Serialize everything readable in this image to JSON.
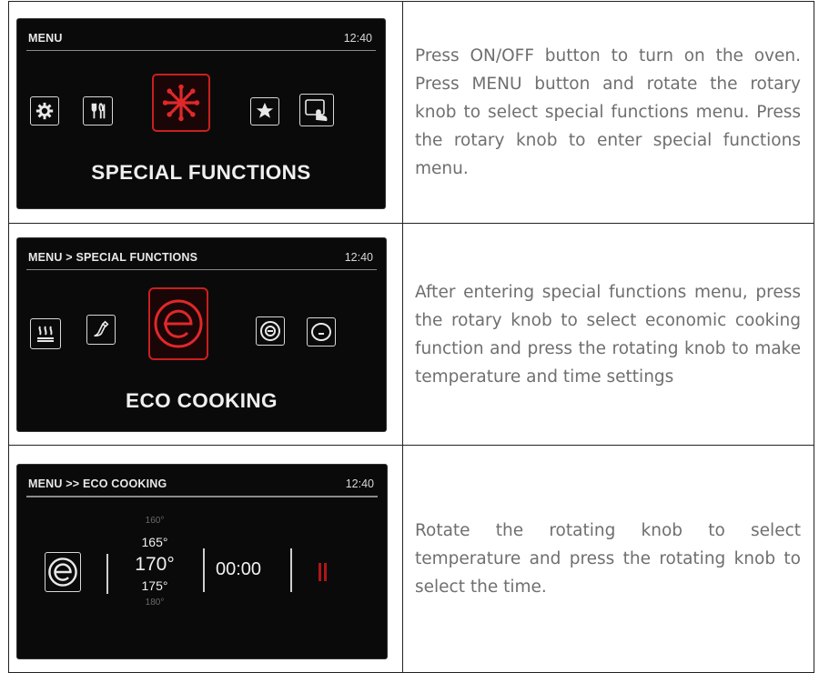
{
  "colors": {
    "screen_bg": "#0a0a0a",
    "accent_red": "#c8201f",
    "text_gray": "#6f6f6f"
  },
  "rows": [
    {
      "screen": {
        "header": "MENU",
        "clock": "12:40",
        "icons": [
          "gear-icon",
          "cutlery-icon",
          "snowflake-icon",
          "star-icon",
          "hand-touch-icon"
        ],
        "selected_icon": "snowflake-icon",
        "caption": "SPECIAL FUNCTIONS"
      },
      "description": "Press ON/OFF button to turn on the oven. Press MENU button and rotate the rotary knob to select special functions menu. Press the rotary knob to enter special functions menu."
    },
    {
      "screen": {
        "header": "MENU > SPECIAL FUNCTIONS",
        "clock": "12:40",
        "icons": [
          "heating-icon",
          "cleaning-icon",
          "eco-icon",
          "plate-icon",
          "dish-icon"
        ],
        "selected_icon": "eco-icon",
        "caption": "ECO COOKING"
      },
      "description": "After entering special functions menu, press the rotary knob to select economic cooking function and press the rotating knob to make temperature and time settings"
    },
    {
      "screen": {
        "header": "MENU >> ECO COOKING",
        "clock": "12:40",
        "temperatures": [
          "160°",
          "165°",
          "170°",
          "175°",
          "180°"
        ],
        "selected_temperature": "170°",
        "time": "00:00",
        "icons": [
          "eco-icon",
          "pause-icon"
        ]
      },
      "description": "Rotate the rotating knob to select temperature and press the rotating knob to select the time."
    }
  ]
}
